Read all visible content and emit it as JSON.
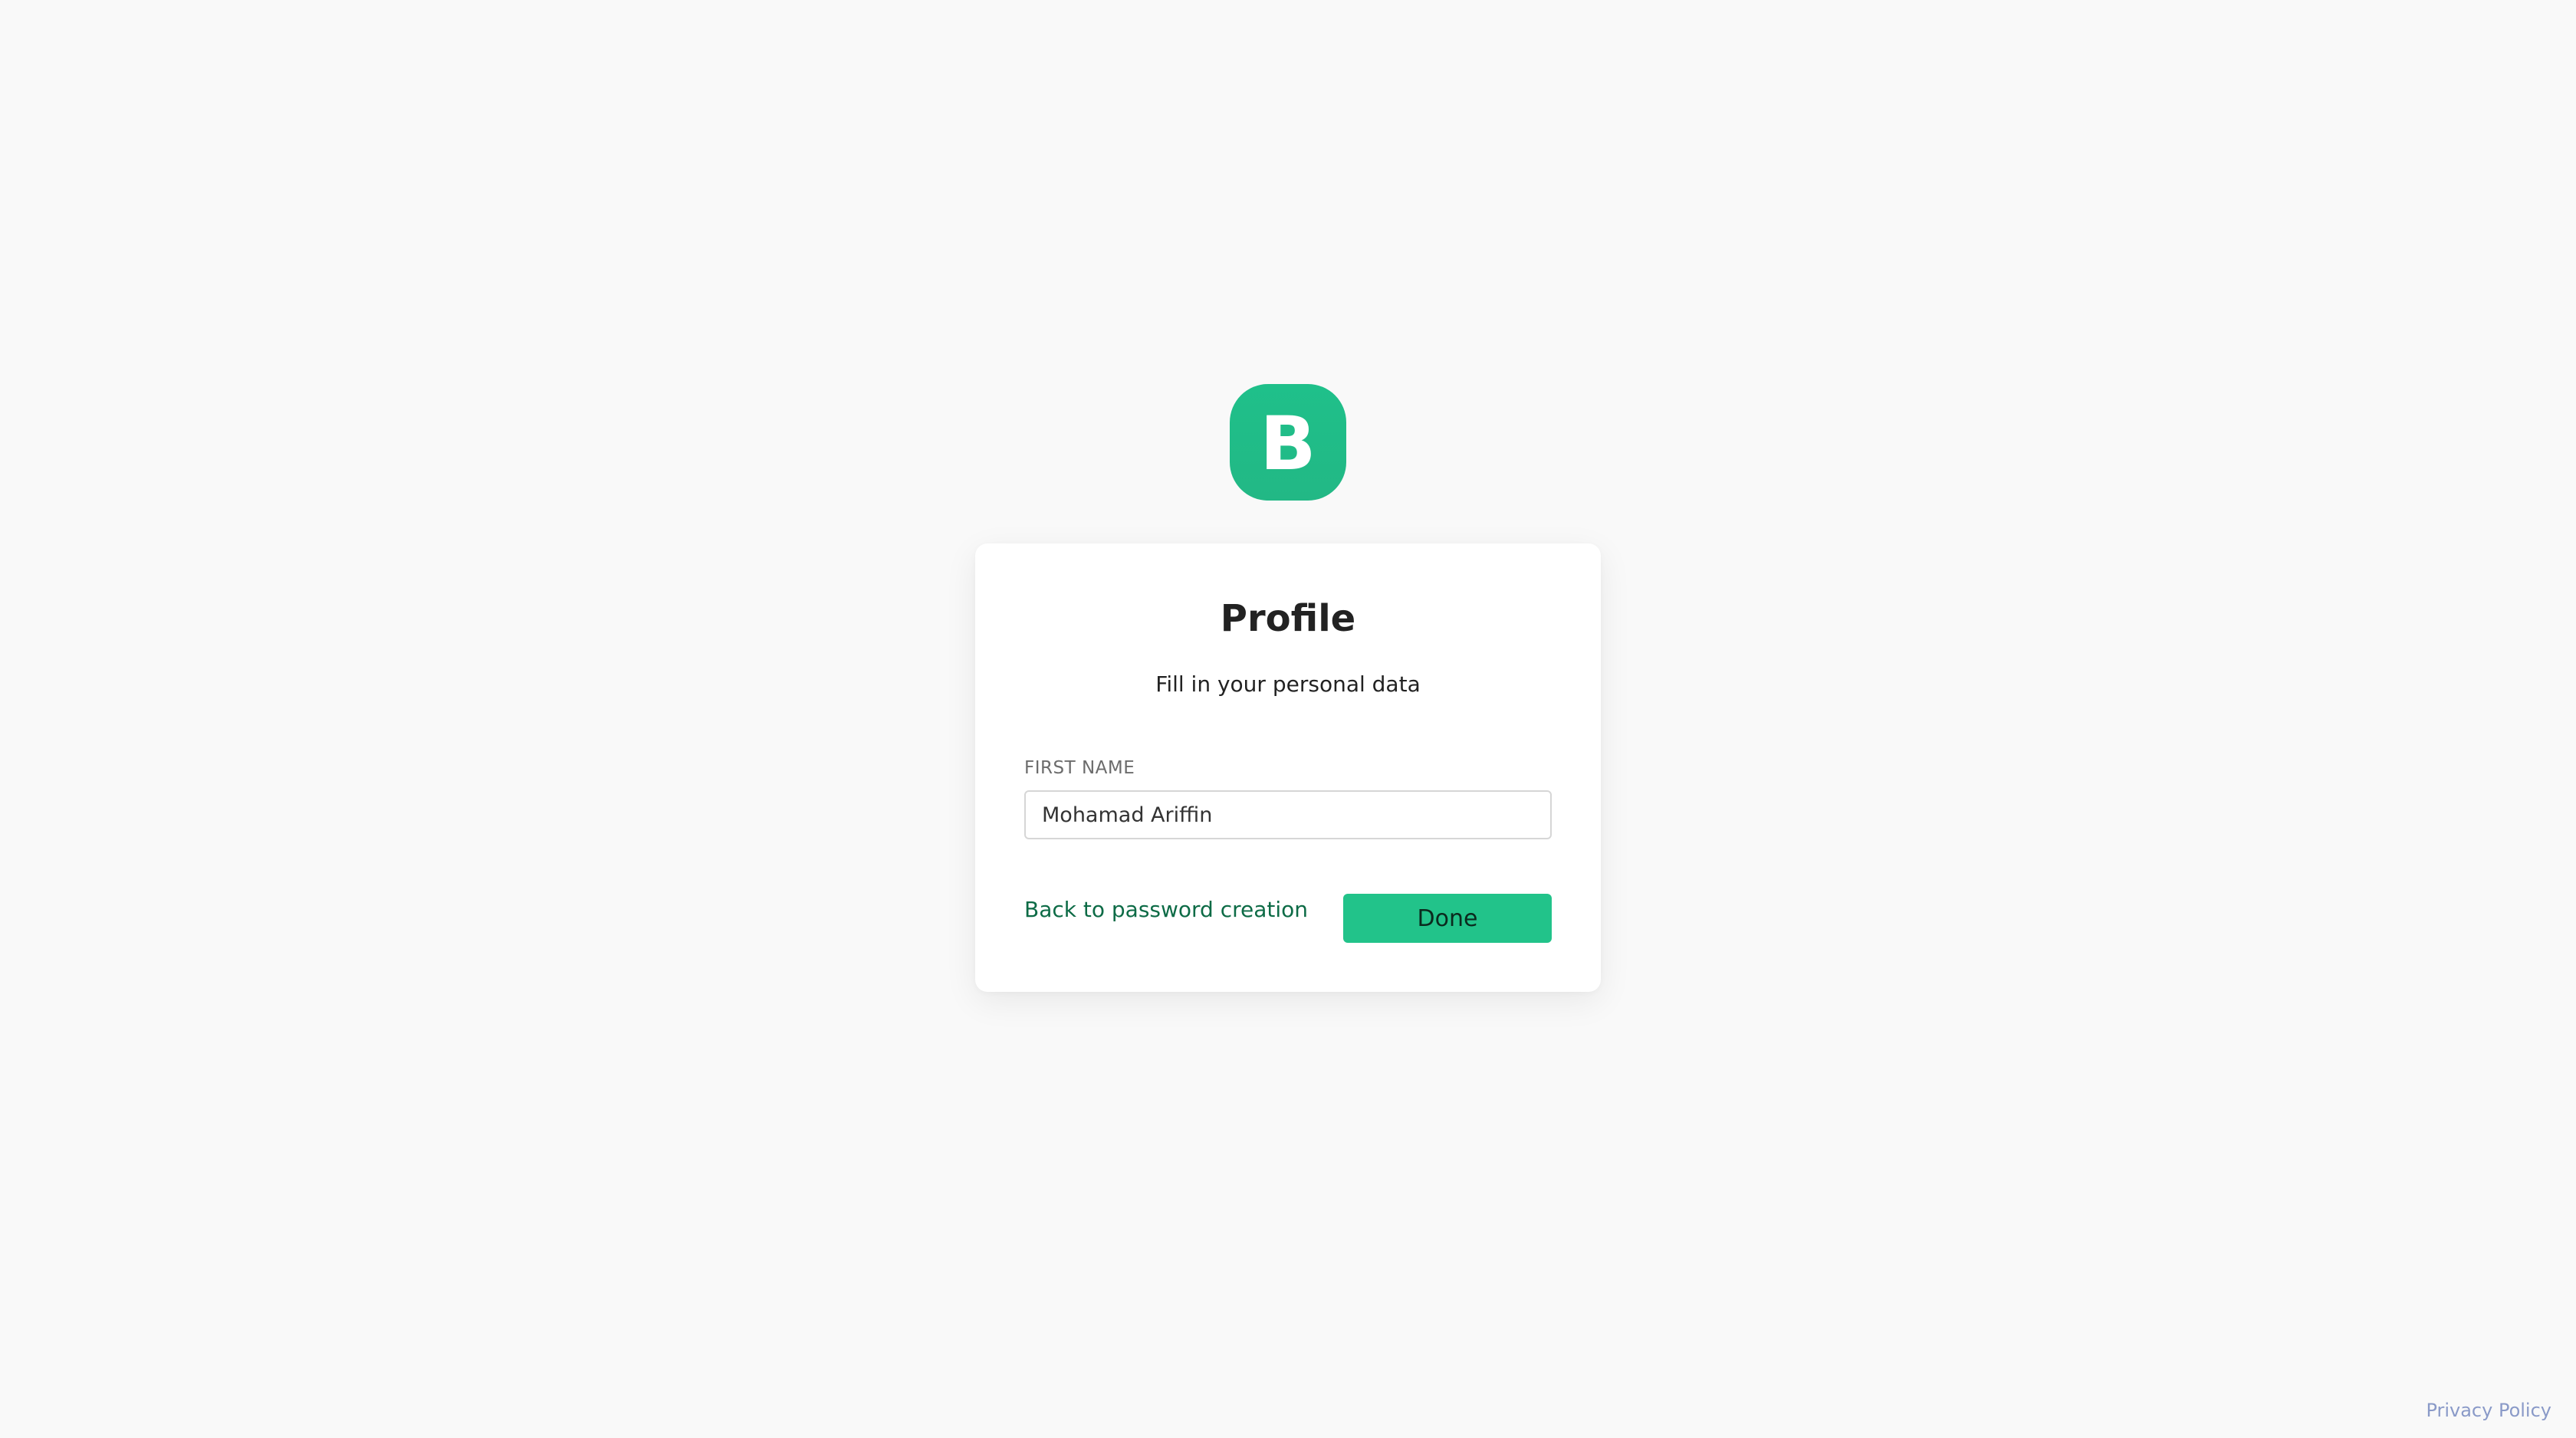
{
  "logo": {
    "letter": "B",
    "color": "#22c38a"
  },
  "card": {
    "title": "Profile",
    "subtitle": "Fill in your personal data",
    "first_name": {
      "label": "FIRST NAME",
      "value": "Mohamad Ariffin"
    },
    "back_link": "Back to password creation",
    "done_button": "Done"
  },
  "footer": {
    "privacy_link": "Privacy Policy"
  },
  "colors": {
    "background": "#f9f9f9",
    "accent": "#22c38a",
    "link": "#0d6b46",
    "footer_link": "#8a9ac8"
  }
}
